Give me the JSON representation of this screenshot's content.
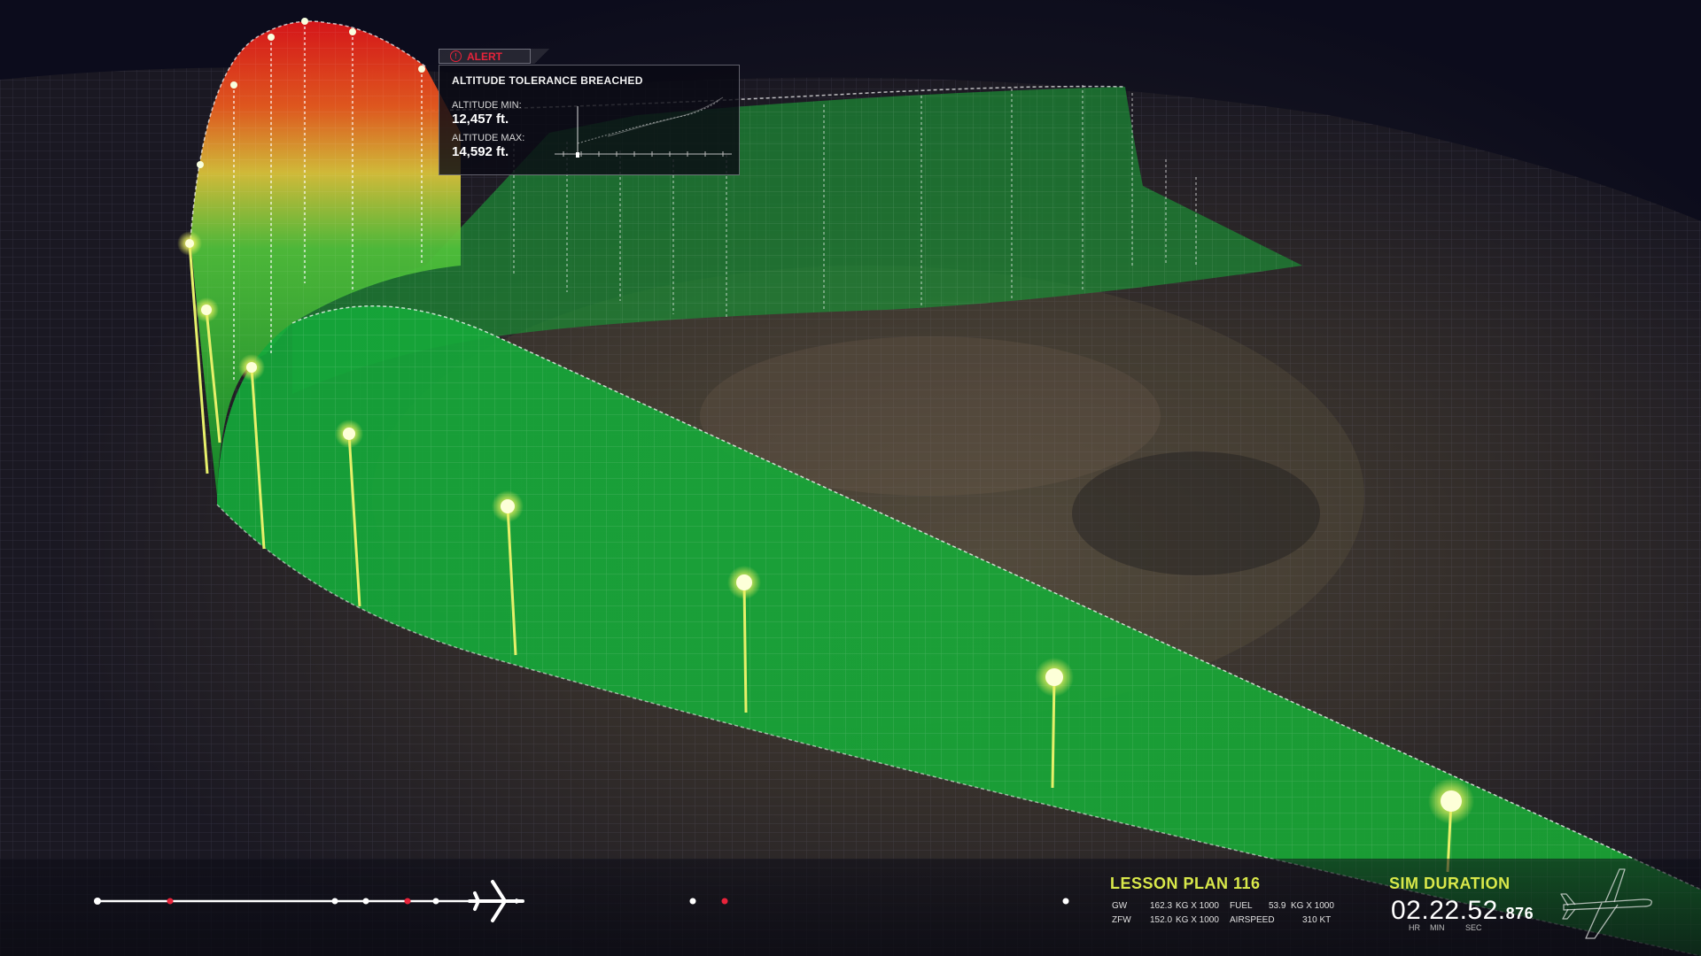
{
  "alert": {
    "tag": "ALERT",
    "title": "ALTITUDE TOLERANCE BREACHED",
    "min_label": "ALTITUDE MIN:",
    "min_value": "12,457 ft.",
    "max_label": "ALTITUDE MAX:",
    "max_value": "14,592 ft."
  },
  "lesson": {
    "title": "LESSON PLAN 116",
    "gw_label": "GW",
    "gw_value": "162.3",
    "gw_unit": "KG X 1000",
    "zfw_label": "ZFW",
    "zfw_value": "152.0",
    "zfw_unit": "KG X 1000",
    "fuel_label": "FUEL",
    "fuel_value": "53.9",
    "fuel_unit": "KG X 1000",
    "airspeed_label": "AIRSPEED",
    "airspeed_value": "310 KT"
  },
  "sim": {
    "title": "SIM DURATION",
    "time_main": "02.22.52.",
    "time_ms": "876",
    "hr_label": "HR",
    "min_label": "MIN",
    "sec_label": "SEC"
  },
  "icons": {
    "alert": "alert-circle-icon",
    "timeline_plane": "airplane-icon",
    "aircraft_outline": "aircraft-outline-icon"
  },
  "colors": {
    "accent_yellow": "#d9e84a",
    "alert_red": "#e8233a",
    "ribbon_green": "#1fbf3a"
  }
}
